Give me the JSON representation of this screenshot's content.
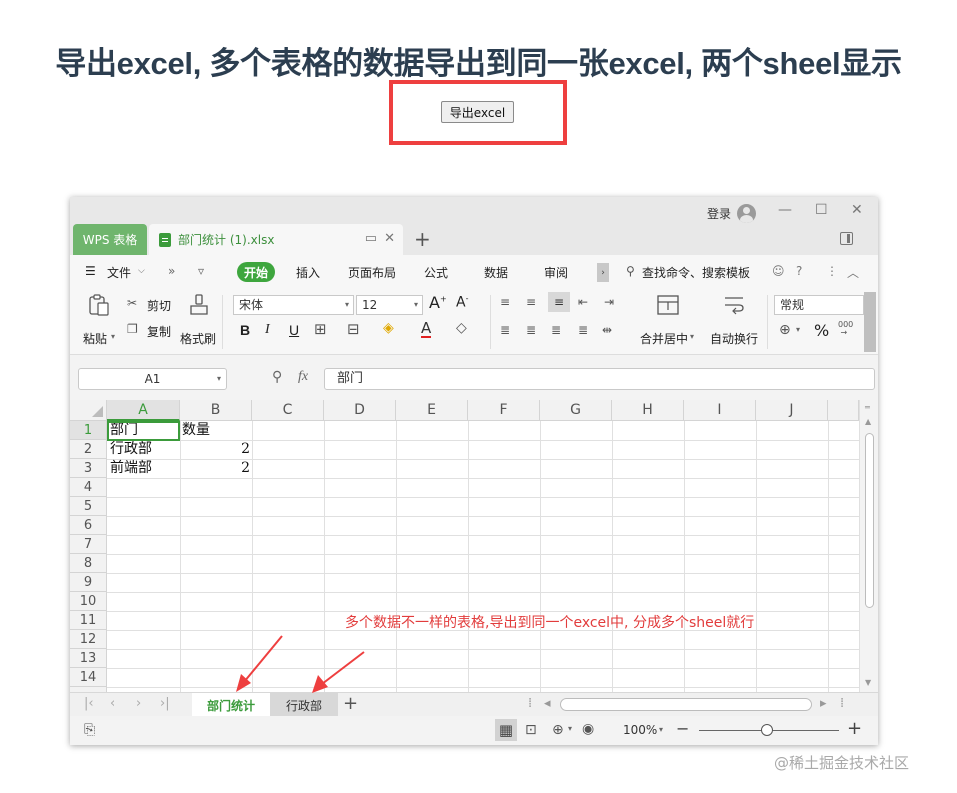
{
  "page": {
    "title": "导出excel, 多个表格的数据导出到同一张excel, 两个sheel显示",
    "export_button": "导出excel",
    "watermark": "@稀土掘金技术社区",
    "highlight_color": "#ee3f3f"
  },
  "wps": {
    "app_tab": "WPS 表格",
    "doc_tab": "部门统计 (1).xlsx",
    "login": "登录",
    "menu": {
      "file": "文件",
      "start": "开始",
      "items": [
        "插入",
        "页面布局",
        "公式",
        "数据",
        "审阅"
      ],
      "search": "查找命令、搜索模板"
    },
    "ribbon": {
      "paste": "粘贴",
      "cut": "剪切",
      "copy": "复制",
      "format_painter": "格式刷",
      "font": "宋体",
      "size": "12",
      "bold": "B",
      "italic": "I",
      "underline": "U",
      "merge": "合并居中",
      "wrap": "自动换行",
      "number_format": "常规",
      "percent": "%"
    },
    "formula_bar": {
      "name_box": "A1",
      "fx": "fx",
      "value": "部门"
    },
    "columns": [
      "A",
      "B",
      "C",
      "D",
      "E",
      "F",
      "G",
      "H",
      "I",
      "J"
    ],
    "rows": [
      "1",
      "2",
      "3",
      "4",
      "5",
      "6",
      "7",
      "8",
      "9",
      "10",
      "11",
      "12",
      "13",
      "14"
    ],
    "cells": {
      "a1": "部门",
      "b1": "数量",
      "a2": "行政部",
      "b2": "2",
      "a3": "前端部",
      "b3": "2"
    },
    "annotation": "多个数据不一样的表格,导出到同一个excel中, 分成多个sheel就行",
    "sheets": [
      "部门统计",
      "行政部"
    ],
    "add_sheet": "+",
    "zoom": "100%",
    "accent_color": "#3b9b3b"
  }
}
